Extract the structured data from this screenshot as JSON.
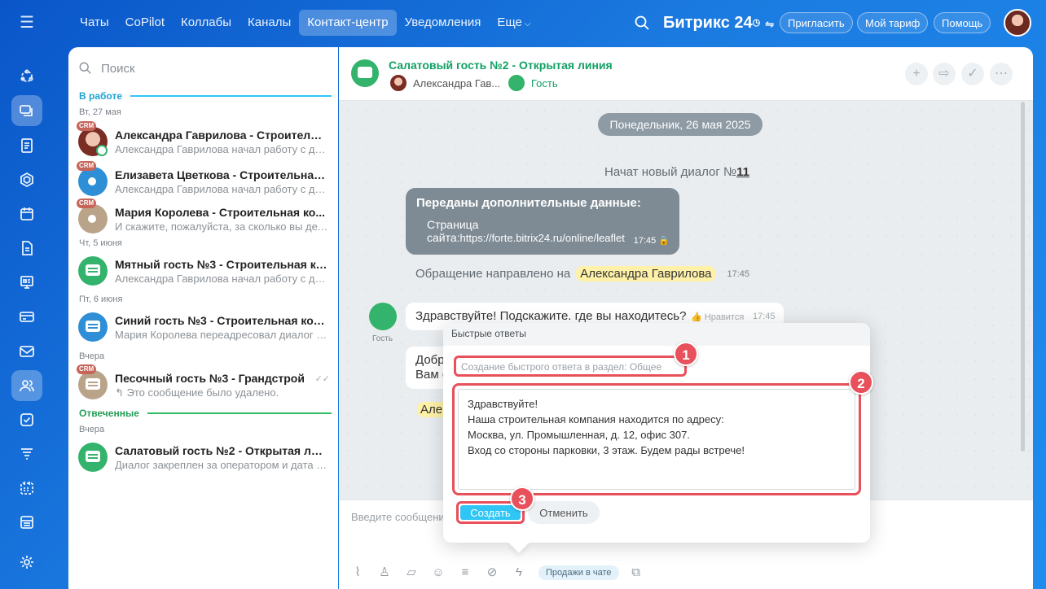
{
  "topnav": {
    "tabs": [
      {
        "label": "Чаты"
      },
      {
        "label": "CoPilot"
      },
      {
        "label": "Коллабы"
      },
      {
        "label": "Каналы"
      },
      {
        "label": "Контакт-центр"
      },
      {
        "label": "Уведомления"
      },
      {
        "label": "Еще"
      }
    ],
    "active_tab": "Контакт-центр",
    "brand": "Битрикс",
    "brand_number": "24",
    "invite": "Пригласить",
    "tariff": "Мой тариф",
    "help": "Помощь"
  },
  "sidebar": {
    "icons": [
      "menu-icon",
      "network-icon",
      "chat-icon",
      "feed-icon",
      "hexagon-icon",
      "calendar-icon",
      "document-icon",
      "presentation-icon",
      "card-icon",
      "mail-icon",
      "people-icon",
      "checkbox-icon",
      "filter-icon",
      "schedule-icon",
      "store-icon",
      "settings-icon"
    ]
  },
  "list": {
    "search_placeholder": "Поиск",
    "section_working": "В работе",
    "section_answered": "Отвеченные",
    "dates": [
      "Вт, 27 мая",
      "Чт, 5 июня",
      "Пт, 6 июня",
      "Вчера",
      "Вчера"
    ],
    "crm_badge": "CRM",
    "items": [
      {
        "title": "Александра Гаврилова - Строительн...",
        "sub": "Александра Гаврилова начал работу с ди..."
      },
      {
        "title": "Елизавета Цветкова - Строительная ...",
        "sub": "Александра Гаврилова начал работу с ди..."
      },
      {
        "title": "Мария Королева - Строительная ко...",
        "sub": "И скажите, пожалуйста, за сколько вы дел..."
      },
      {
        "title": "Мятный гость №3 - Строительная ко...",
        "sub": "Александра Гаврилова начал работу с ди..."
      },
      {
        "title": "Синий гость №3 - Строительная ком...",
        "sub": "Мария Королева переадресовал диалог н..."
      },
      {
        "title": "Песочный гость №3 - Грандстрой",
        "sub": "Это сообщение было удалено."
      },
      {
        "title": "Салатовый гость №2 - Открытая лин...",
        "sub": "Диалог закреплен за оператором и дата а..."
      }
    ]
  },
  "chat": {
    "title": "Салатовый гость №2 - Открытая линия",
    "member1": "Александра Гав...",
    "member2": "Гость",
    "date_pill": "Понедельник, 26 мая 2025",
    "new_dialog_prefix": "Начат новый диалог №",
    "new_dialog_number": "11",
    "card_title": "Переданы дополнительные данные:",
    "card_label": "Страница сайта:",
    "card_url": "https://forte.bitrix24.ru/online/leaflet",
    "card_time": "17:45",
    "routed_text": "Обращение направлено на",
    "routed_name": "Александра Гаврилова",
    "routed_time": "17:45",
    "guest_label": "Гость",
    "msg1": "Здравствуйте! Подскажите. где вы находитесь?",
    "msg1_like": "Нравится",
    "msg1_time": "17:45",
    "msg2": "Добр\nВам с",
    "hl2": "Але",
    "composer_placeholder": "Введите сообщени",
    "sales_label": "Продажи в чате"
  },
  "quick_replies": {
    "title": "Быстрые ответы",
    "section": "Создание быстрого ответа в раздел: Общее",
    "text": "Здравствуйте!\nНаша строительная компания находится по адресу:\nМосква, ул. Промышленная, д. 12, офис 307.\nВход со стороны парковки, 3 этаж. Будем рады встрече!",
    "create": "Создать",
    "cancel": "Отменить",
    "badges": [
      "1",
      "2",
      "3"
    ]
  },
  "colors": {
    "accent": "#2fc6f6",
    "annotation": "#e8505b",
    "title_green": "#12a064",
    "brand_blue": "#1b7be0"
  }
}
